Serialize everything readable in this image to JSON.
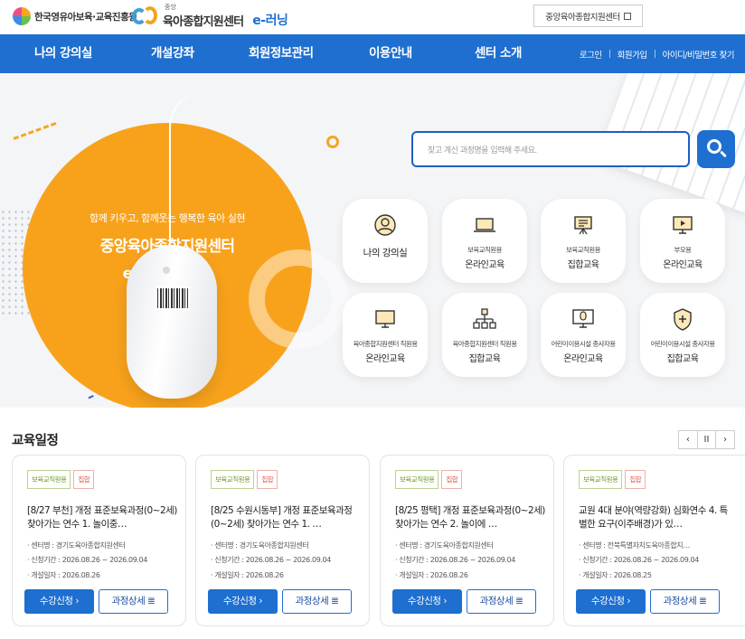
{
  "header": {
    "logo1_text": "한국영유아보육·교육진흥원",
    "logo2_small": "중앙",
    "logo2_name": "육아종합지원센터",
    "logo2_sub": "e-러닝",
    "ext_link": "중앙육아종합지원센터"
  },
  "nav": {
    "items": [
      "나의 강의실",
      "개설강좌",
      "회원정보관리",
      "이용안내",
      "센터 소개"
    ],
    "util": [
      "로그인",
      "회원가입",
      "아이디/비밀번호 찾기"
    ]
  },
  "hero": {
    "tagline": "함께 키우고, 함께웃는 행복한 육아 실현",
    "title1": "중앙육아종합지원센터",
    "title2": "e-러닝 사이트",
    "search_placeholder": "찾고 계신 과정명을 입력해 주세요."
  },
  "quick": [
    {
      "icon": "user-circle-icon",
      "line1": "",
      "line2": "나의 강의실"
    },
    {
      "icon": "laptop-icon",
      "line1": "보육교직원용",
      "line2": "온라인교육"
    },
    {
      "icon": "presentation-board-icon",
      "line1": "보육교직원용",
      "line2": "집합교육"
    },
    {
      "icon": "monitor-play-icon",
      "line1": "부모용",
      "line2": "온라인교육"
    },
    {
      "icon": "monitor-icon",
      "line1": "육아종합지원센터 직원용",
      "line2": "온라인교육"
    },
    {
      "icon": "org-chart-icon",
      "line1": "육아종합지원센터 직원용",
      "line2": "집합교육"
    },
    {
      "icon": "monitor-mic-icon",
      "line1": "어린이이용시설 종사자용",
      "line2": "온라인교육"
    },
    {
      "icon": "shield-plus-icon",
      "line1": "어린이이용시설 종사자용",
      "line2": "집합교육"
    }
  ],
  "schedule": {
    "title": "교육일정",
    "controls": [
      "‹",
      "II",
      "›"
    ],
    "cards": [
      {
        "tag1": "보육교직원용",
        "tag2": "집합",
        "title": "[8/27 부천] 개정 표준보육과정(0~2세) 찾아가는 연수 1. 놀이중…",
        "center": "· 센터명 : 경기도육아종합지원센터",
        "period": "· 신청기간 : 2026.08.26 ~ 2026.09.04",
        "open": "· 개설일자 : 2026.08.26",
        "apply": "수강신청",
        "detail": "과정상세"
      },
      {
        "tag1": "보육교직원용",
        "tag2": "집합",
        "title": "[8/25 수원시동부] 개정 표준보육과정(0~2세) 찾아가는 연수 1. …",
        "center": "· 센터명 : 경기도육아종합지원센터",
        "period": "· 신청기간 : 2026.08.26 ~ 2026.09.04",
        "open": "· 개설일자 : 2026.08.26",
        "apply": "수강신청",
        "detail": "과정상세"
      },
      {
        "tag1": "보육교직원용",
        "tag2": "집합",
        "title": "[8/25 평택] 개정 표준보육과정(0~2세) 찾아가는 연수 2. 놀이에 …",
        "center": "· 센터명 : 경기도육아종합지원센터",
        "period": "· 신청기간 : 2026.08.26 ~ 2026.09.04",
        "open": "· 개설일자 : 2026.08.26",
        "apply": "수강신청",
        "detail": "과정상세"
      },
      {
        "tag1": "보육교직원용",
        "tag2": "집합",
        "title": "교원 4대 분야(역량강화) 심화연수 4. 특별한 요구(이주배경)가 있…",
        "center": "· 센터명 : 전북특별자치도육아종합지…",
        "period": "· 신청기간 : 2026.08.26 ~ 2026.09.04",
        "open": "· 개설일자 : 2026.08.25",
        "apply": "수강신청",
        "detail": "과정상세"
      }
    ]
  },
  "colors": {
    "primary": "#1e6fd0",
    "orange": "#f8a21c"
  }
}
